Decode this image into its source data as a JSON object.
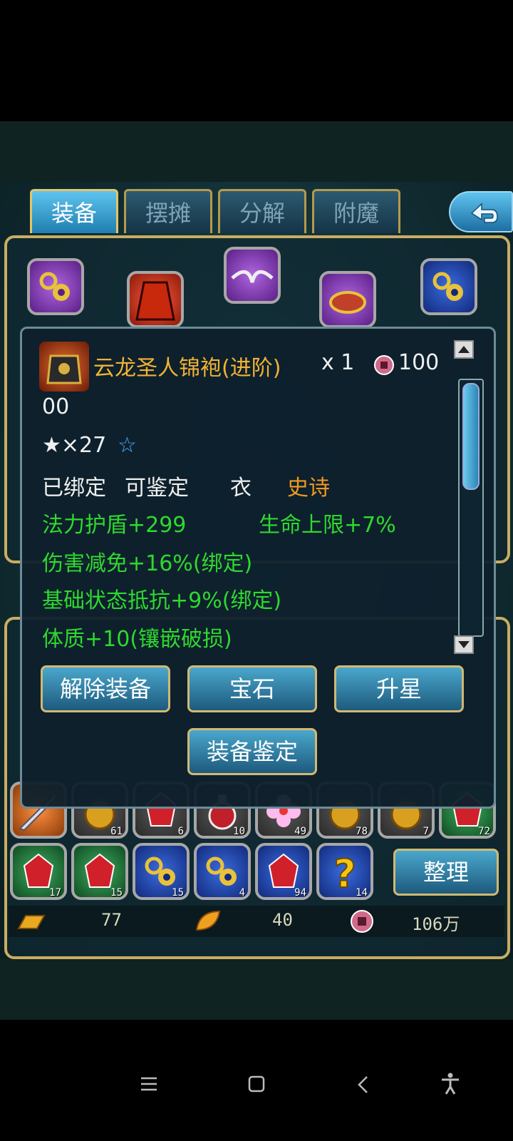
{
  "tabs": [
    {
      "label": "装备",
      "active": true
    },
    {
      "label": "摆摊",
      "active": false
    },
    {
      "label": "分解",
      "active": false
    },
    {
      "label": "附魔",
      "active": false
    }
  ],
  "tooltip": {
    "item_name": "云龙圣人锦袍(进阶)",
    "quantity": "x 1",
    "price_line1": "100",
    "price_line2": "00",
    "star_text": "★×27",
    "star_outline": "☆",
    "status": {
      "bound": "已绑定",
      "identifiable": "可鉴定",
      "slot": "衣",
      "quality": "史诗"
    },
    "attrs": [
      {
        "left": "法力护盾+299",
        "right": "生命上限+7%"
      },
      {
        "left": "伤害减免+16%(绑定)"
      },
      {
        "left": "基础状态抵抗+9%(绑定)"
      },
      {
        "left": "体质+10(镶嵌破损)"
      }
    ],
    "buttons": {
      "unequip": "解除装备",
      "gem": "宝石",
      "upgrade_star": "升星",
      "identify": "装备鉴定"
    }
  },
  "bag": {
    "row1": [
      {
        "icon": "sword-icon",
        "count": ""
      },
      {
        "icon": "bag-icon",
        "count": "61"
      },
      {
        "icon": "red-gem-icon",
        "count": "6"
      },
      {
        "icon": "potion-icon",
        "count": "10"
      },
      {
        "icon": "flower-icon",
        "count": "49"
      },
      {
        "icon": "bag-icon",
        "count": "78"
      },
      {
        "icon": "bag-icon",
        "count": "7"
      },
      {
        "icon": "red-gem-icon",
        "count": "72"
      }
    ],
    "row2": [
      {
        "icon": "red-gem-icon",
        "count": "17"
      },
      {
        "icon": "red-gem-icon",
        "count": "15"
      },
      {
        "icon": "chain-icon",
        "count": "15"
      },
      {
        "icon": "chain-icon",
        "count": "4"
      },
      {
        "icon": "red-gem-icon",
        "count": "94"
      },
      {
        "icon": "question-icon",
        "count": "14"
      }
    ],
    "sort_button": "整理"
  },
  "currency": {
    "gold": "77",
    "leaf": "40",
    "coin": "106万"
  },
  "colors": {
    "gold_frame": "#c9ad62",
    "green_attr": "#2fd82f",
    "quality_epic": "#f29a20"
  }
}
